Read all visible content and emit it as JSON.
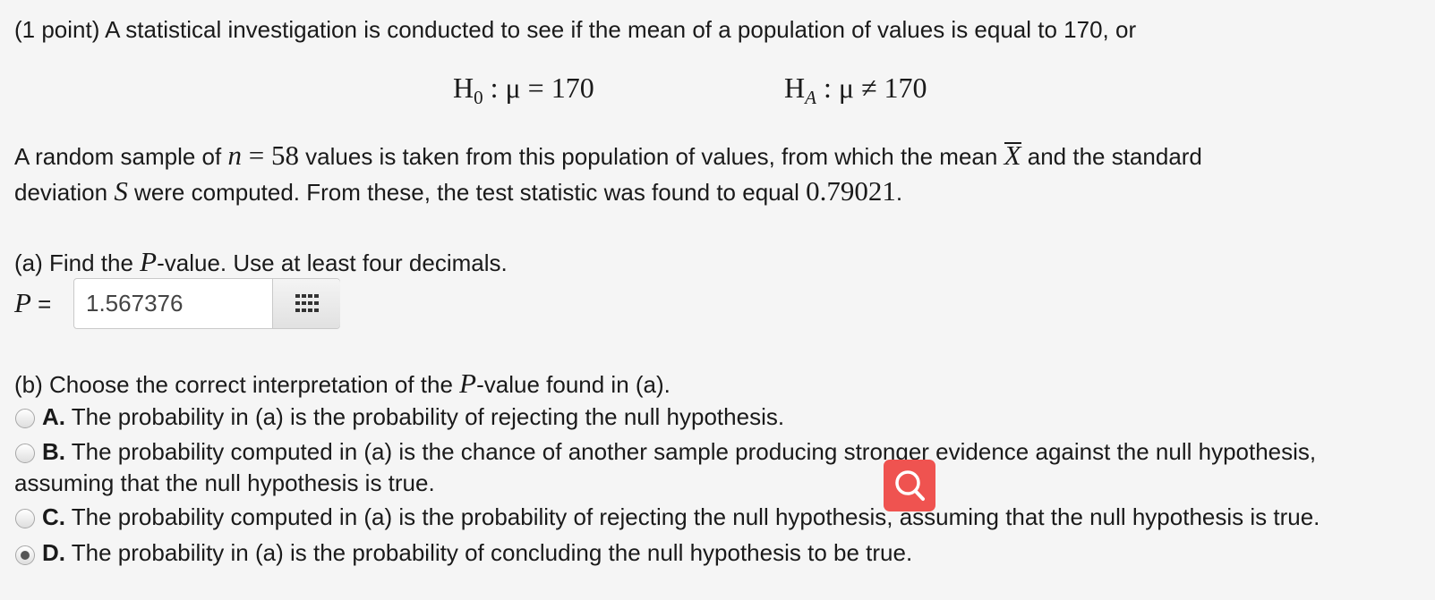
{
  "problem": {
    "intro": "(1 point) A statistical investigation is conducted to see if the mean of a population of values is equal to 170, or",
    "h0": {
      "label": "H",
      "sub": "0",
      "rel": " : μ = 170"
    },
    "ha": {
      "label": "H",
      "sub": "A",
      "rel": " : μ ≠ 170"
    },
    "sample_text_1": "A random sample of ",
    "n_var": "n",
    "n_eq": " = 58",
    "sample_text_2": " values is taken from this population of values, from which the mean ",
    "xbar": "X",
    "sample_text_3": " and the standard",
    "line2_text_1": "deviation ",
    "s_var": "S",
    "line2_text_2": " were computed. From these, the test statistic was found to equal ",
    "test_stat": "0.79021",
    "line2_end": "."
  },
  "part_a": {
    "text_1": "(a) Find the ",
    "p_var": "P",
    "text_2": "-value. Use at least four decimals.",
    "answer_label": "P",
    "answer_eq": " =",
    "answer_value": "1.567376"
  },
  "part_b": {
    "text_1": "(b) Choose the correct interpretation of the ",
    "p_var": "P",
    "text_2": "-value found in (a).",
    "options": [
      {
        "letter": "A.",
        "text": " The probability in (a) is the probability of rejecting the null hypothesis.",
        "selected": false
      },
      {
        "letter": "B.",
        "text": " The probability computed in (a) is the chance of another sample producing stronger evidence against the null hypothesis,",
        "text_cont": "assuming that the null hypothesis is true.",
        "selected": false
      },
      {
        "letter": "C.",
        "text": " The probability computed in (a) is the probability of rejecting the null hypothesis, assuming that the null hypothesis is true.",
        "selected": false
      },
      {
        "letter": "D.",
        "text": " The probability in (a) is the probability of concluding the null hypothesis to be true.",
        "selected": true
      }
    ]
  },
  "icons": {
    "keypad": "grid-icon",
    "search": "search-icon"
  },
  "colors": {
    "search_button": "#ef5350",
    "background": "#f5f5f5"
  }
}
